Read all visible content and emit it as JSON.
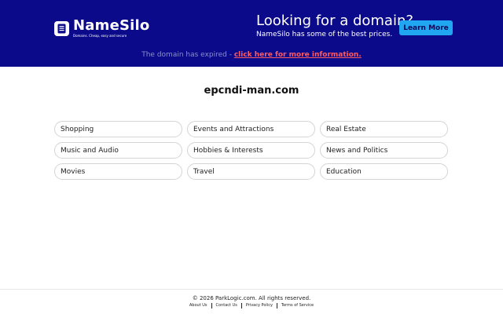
{
  "banner": {
    "logo_name": "NameSilo",
    "logo_tagline": "Domains. Cheap, easy and secure",
    "headline": "Looking for a domain?",
    "subline": "NameSilo has some of the best prices.",
    "learn_more": "Learn More",
    "expired_text": "The domain has expired - ",
    "expired_link": "click here for more information.",
    "colors": {
      "background": "#0b0a8a",
      "button": "#21a6f2",
      "link": "#ff5a62"
    }
  },
  "domain_name": "epcndi-man.com",
  "categories": [
    "Shopping",
    "Events and Attractions",
    "Real Estate",
    "Music and Audio",
    "Hobbies & Interests",
    "News and Politics",
    "Movies",
    "Travel",
    "Education"
  ],
  "footer": {
    "copyright": "© 2026 ParkLogic.com. All rights reserved.",
    "links": [
      "About Us",
      "Contact Us",
      "Privacy Policy",
      "Terms of Service"
    ]
  }
}
